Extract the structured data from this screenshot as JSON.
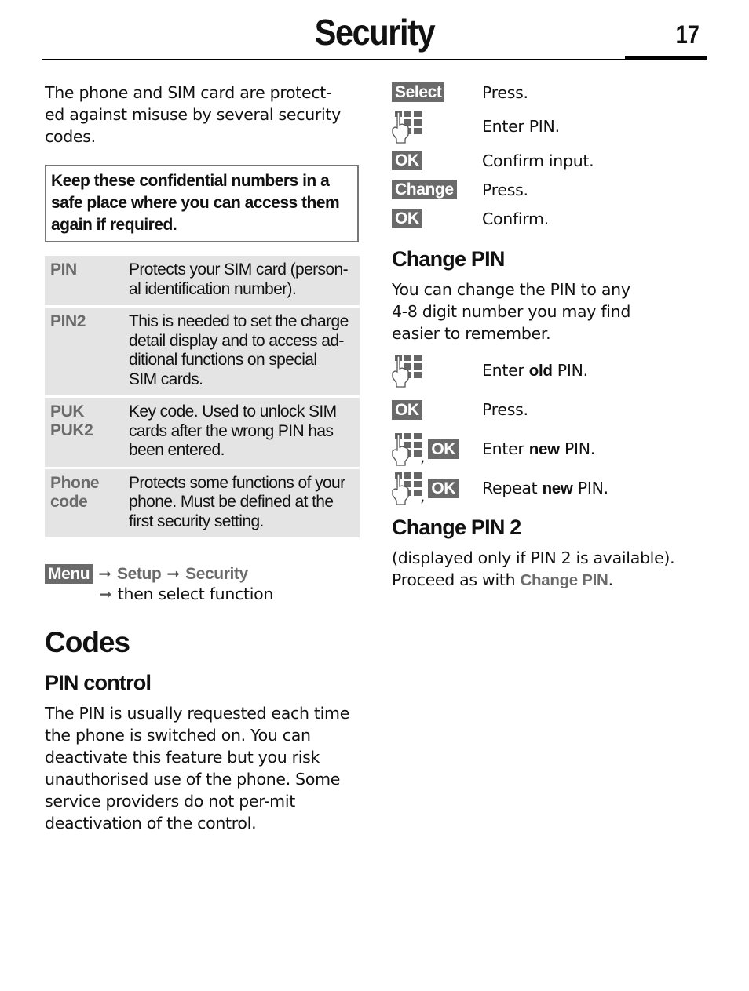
{
  "header": {
    "title": "Security",
    "page_number": "17"
  },
  "left": {
    "intro": "The phone and SIM card are protect-\ned against misuse by several security\ncodes.",
    "notice": "Keep these confidential numbers in a safe place where you can access them again if required.",
    "codes": [
      {
        "name": "PIN",
        "description": "Protects your SIM card (person-\nal identification number)."
      },
      {
        "name": "PIN2",
        "description": "This is needed to set the charge\ndetail display and to access ad-\nditional functions on special\nSIM cards."
      },
      {
        "name": "PUK\nPUK2",
        "description": "Key code. Used to unlock SIM\ncards after the wrong PIN has\nbeen entered."
      },
      {
        "name": "Phone\ncode",
        "description": "Protects some functions of your\nphone. Must be defined at the\nfirst security setting."
      }
    ],
    "menu_path": {
      "key": "Menu",
      "items": [
        "Setup",
        "Security"
      ],
      "final": "then select function"
    },
    "codes_heading": "Codes",
    "pin_control_heading": "PIN control",
    "pin_control_text": "The PIN is usually requested each time the phone is switched on. You can deactivate this feature but you risk unauthorised use of the phone. Some service providers do not per-mit deactivation of the control."
  },
  "right": {
    "steps_pin_control": [
      {
        "icon": "softkey",
        "key": "Select",
        "text": "Press."
      },
      {
        "icon": "keypad",
        "text": "Enter PIN."
      },
      {
        "icon": "softkey",
        "key": "OK",
        "text": "Confirm input."
      },
      {
        "icon": "softkey",
        "key": "Change",
        "text": "Press."
      },
      {
        "icon": "softkey",
        "key": "OK",
        "text": "Confirm."
      }
    ],
    "change_pin_heading": "Change PIN",
    "change_pin_text": "You can change the PIN to any\n4-8 digit number you may find\neasier to remember.",
    "steps_change_pin": [
      {
        "icon": "keypad",
        "text_pre": "Enter ",
        "bold": "old",
        "text_post": " PIN."
      },
      {
        "icon": "softkey",
        "key": "OK",
        "text": "Press."
      },
      {
        "icon": "keypad+softkey",
        "key": "OK",
        "text_pre": "Enter ",
        "bold": "new",
        "text_post": " PIN."
      },
      {
        "icon": "keypad+softkey",
        "key": "OK",
        "text_pre": "Repeat ",
        "bold": "new",
        "text_post": " PIN."
      }
    ],
    "change_pin2_heading": "Change PIN 2",
    "change_pin2_text_1": "(displayed only if PIN 2 is available).",
    "change_pin2_text_2_pre": "Proceed as with ",
    "change_pin2_ref": "Change PIN",
    "change_pin2_text_2_post": "."
  },
  "colors": {
    "softkey_bg": "#6a6a6a",
    "code_name": "#6b6b6b",
    "table_bg": "#e4e4e4"
  }
}
